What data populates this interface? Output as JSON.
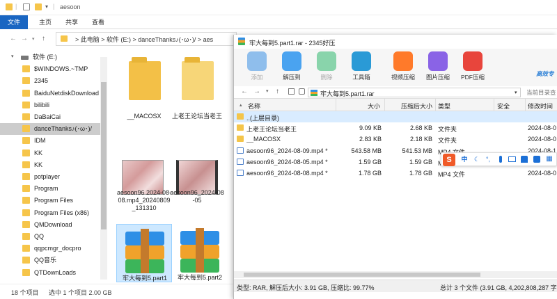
{
  "explorer": {
    "title": "aesoon",
    "ribbon_tabs": [
      "文件",
      "主页",
      "共享",
      "查看"
    ],
    "address": "> 此电脑 > 软件 (E:) > danceThanks♪(･ω･)/ > aes",
    "sidebar": [
      {
        "label": "软件 (E:)",
        "drive": true
      },
      {
        "label": "$WINDOWS.~TMP"
      },
      {
        "label": "2345"
      },
      {
        "label": "BaiduNetdiskDownload"
      },
      {
        "label": "bilibili"
      },
      {
        "label": "DaBaiCai"
      },
      {
        "label": "danceThanks♪(･ω･)/",
        "selected": true
      },
      {
        "label": "IDM"
      },
      {
        "label": "KK"
      },
      {
        "label": "KK"
      },
      {
        "label": "potplayer"
      },
      {
        "label": "Program"
      },
      {
        "label": "Program Files"
      },
      {
        "label": "Program Files (x86)"
      },
      {
        "label": "QMDownload"
      },
      {
        "label": "QQ"
      },
      {
        "label": "qqpcmgr_docpro"
      },
      {
        "label": "QQ音乐"
      },
      {
        "label": "QTDownLoads"
      }
    ],
    "items": [
      {
        "label": "__MACOSX",
        "kind": "folder"
      },
      {
        "label": "上老王论坛当老王",
        "kind": "folder"
      },
      {
        "label": "aesoon96 2024-08-08.mp4_20240809_131310",
        "kind": "video"
      },
      {
        "label": "aesoon96_2024-08-05",
        "kind": "video2"
      },
      {
        "label": "牢大每到5.part1",
        "kind": "rar",
        "selected": true
      },
      {
        "label": "牢大每到5.part2",
        "kind": "rar"
      }
    ],
    "status": {
      "count": "18 个项目",
      "selected": "选中 1 个项目  2.00 GB"
    }
  },
  "winrar": {
    "title": "牢大每到5.part1.rar - 2345好压",
    "toolbar": [
      {
        "label": "添加",
        "color": "#3a8fe3",
        "disabled": true
      },
      {
        "label": "解压到",
        "color": "#4aa3f0",
        "disabled": false
      },
      {
        "label": "删除",
        "color": "#2fb86e",
        "disabled": true
      },
      {
        "label": "工具箱",
        "color": "#2a9ad6",
        "disabled": false
      },
      {
        "label": "视频压缩",
        "color": "#ff7a2a",
        "disabled": false
      },
      {
        "label": "图片压缩",
        "color": "#8a63e6",
        "disabled": false
      },
      {
        "label": "PDF压缩",
        "color": "#e8453c",
        "disabled": false
      }
    ],
    "brand": "高效专",
    "path": "牢大每到5.part1.rar",
    "search_placeholder": "当前目录查",
    "columns": [
      "名称",
      "大小",
      "压缩后大小",
      "类型",
      "安全",
      "修改时间"
    ],
    "rows": [
      {
        "name": "..(上层目录)",
        "size": "",
        "packed": "",
        "type": "",
        "security": "",
        "modified": "",
        "icon": "folder",
        "selected": true
      },
      {
        "name": "上老王论坛当老王",
        "size": "9.09 KB",
        "packed": "2.68 KB",
        "type": "文件夹",
        "security": "",
        "modified": "2024-08-0",
        "icon": "folder"
      },
      {
        "name": "__MACOSX",
        "size": "2.83 KB",
        "packed": "2.18 KB",
        "type": "文件夹",
        "security": "",
        "modified": "2024-08-0",
        "icon": "folder"
      },
      {
        "name": "aesoon96_2024-08-09.mp4 *",
        "size": "543.58 MB",
        "packed": "541.53 MB",
        "type": "MP4 文件",
        "security": "",
        "modified": "2024-08-1",
        "icon": "file"
      },
      {
        "name": "aesoon96_2024-08-05.mp4 *",
        "size": "1.59 GB",
        "packed": "1.59 GB",
        "type": "MP4 文件",
        "security": "",
        "modified": "2024-08-0",
        "icon": "file"
      },
      {
        "name": "aesoon96_2024-08-08.mp4 *",
        "size": "1.78 GB",
        "packed": "1.78 GB",
        "type": "MP4 文件",
        "security": "",
        "modified": "2024-08-0",
        "icon": "file"
      }
    ],
    "status_left": "类型: RAR, 解压后大小: 3.91 GB, 压缩比: 99.77%",
    "status_right": "总计 3 个文件 (3.91 GB, 4,202,808,287 字"
  },
  "ime": {
    "label": "中",
    "icons": [
      "moon-icon",
      "punct-icon",
      "mic-icon",
      "keyboard-icon",
      "shirt-icon",
      "toolbox-icon",
      "grid-icon"
    ]
  }
}
